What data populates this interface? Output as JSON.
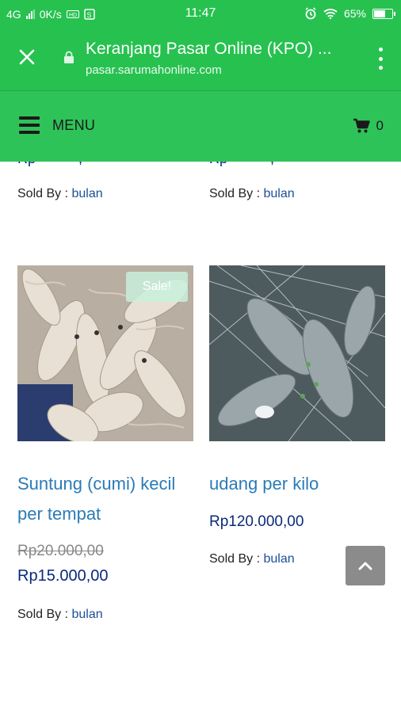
{
  "status_bar": {
    "network": "4G",
    "speed": "0K/s",
    "time": "11:47",
    "battery": "65%",
    "battery_level": 0.65
  },
  "browser": {
    "title": "Keranjang Pasar Online (KPO) ...",
    "url": "pasar.sarumahonline.com"
  },
  "header": {
    "menu_label": "MENU",
    "cart_count": "0"
  },
  "products_top": [
    {
      "sold_by_label": "Sold By :",
      "vendor": "bulan"
    },
    {
      "sold_by_label": "Sold By :",
      "vendor": "bulan"
    }
  ],
  "products": [
    {
      "badge": "Sale!",
      "title_line1": "Suntung (cumi) kecil",
      "title_line2": "per tempat",
      "old_price": "Rp20.000,00",
      "price": "Rp15.000,00",
      "sold_by_label": "Sold By :",
      "vendor": "bulan"
    },
    {
      "title_line1": "udang per kilo",
      "price": "Rp120.000,00",
      "sold_by_label": "Sold By :",
      "vendor": "bulan"
    }
  ],
  "icons": {
    "close": "close-icon",
    "lock": "lock-icon",
    "menu": "hamburger-icon",
    "cart": "cart-icon",
    "options": "more-vert-icon",
    "scroll_top": "chevron-up-icon"
  },
  "colors": {
    "brand_green": "#2ec359",
    "link_blue": "#2a7bb8",
    "price_navy": "#0a2a7a"
  }
}
